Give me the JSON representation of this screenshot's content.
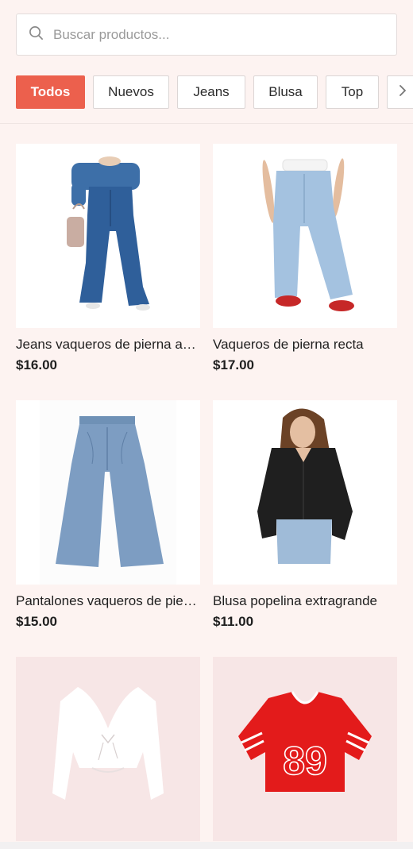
{
  "search": {
    "placeholder": "Buscar productos..."
  },
  "filters": [
    {
      "label": "Todos",
      "active": true
    },
    {
      "label": "Nuevos",
      "active": false
    },
    {
      "label": "Jeans",
      "active": false
    },
    {
      "label": "Blusa",
      "active": false
    },
    {
      "label": "Top",
      "active": false
    }
  ],
  "icons": {
    "search": "search-icon",
    "more": "chevron-right-icon"
  },
  "colors": {
    "accent": "#ec604d",
    "background": "#fdf3f1"
  },
  "products": [
    {
      "name": "Jeans vaqueros de pierna a…",
      "price": "$16.00"
    },
    {
      "name": "Vaqueros de pierna recta",
      "price": "$17.00"
    },
    {
      "name": "Pantalones vaqueros de pie…",
      "price": "$15.00"
    },
    {
      "name": "Blusa popelina extragrande",
      "price": "$11.00"
    },
    {
      "name": "",
      "price": ""
    },
    {
      "name": "",
      "price": ""
    }
  ]
}
